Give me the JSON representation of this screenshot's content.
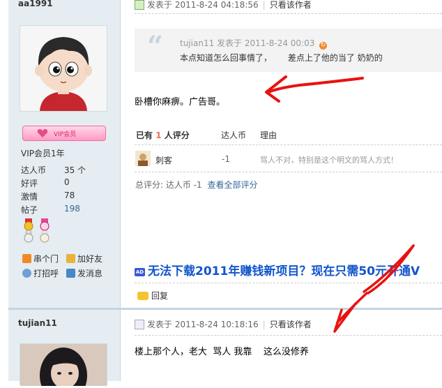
{
  "post1": {
    "author": "aa1991",
    "rank": "VIP会员1年",
    "vip_badge": "VIP会员",
    "stats": [
      {
        "label": "达人币",
        "value": "35 个"
      },
      {
        "label": "好评",
        "value": "0"
      },
      {
        "label": "激情",
        "value": "78"
      },
      {
        "label": "帖子",
        "value": "198"
      }
    ],
    "links": {
      "visit": "串个门",
      "add_friend": "加好友",
      "greet": "打招呼",
      "message": "发消息"
    },
    "time": "发表于 2011-8-24 04:18:56",
    "only_author": "只看该作者",
    "quote": {
      "author": "tujian11",
      "time": "发表于 2011-8-24 00:03",
      "text": "本点知道怎么回事情了，      差点上了他的当了 奶奶的"
    },
    "message": "卧槽你麻痹。广告哥。",
    "rating": {
      "head_prefix": "已有",
      "count": "1",
      "head_suffix": "人评分",
      "col_coin": "达人币",
      "col_reason": "理由",
      "rater": "刺客",
      "coin": "-1",
      "reason": "骂人不对，特别是这个明文的骂人方式！",
      "total_label": "总评分:",
      "total_value": "达人币 -1",
      "view_all": "查看全部评分"
    },
    "ad": "无法下载2011年赚钱新项目？现在只需50元开通V",
    "ad_icon": "AD",
    "reply": "回复"
  },
  "post2": {
    "author": "tujian11",
    "time": "发表于 2011-8-24 10:18:16",
    "only_author": "只看该作者",
    "message": "楼上那个人，老大  骂人 我靠    这么没修养"
  },
  "colors": {
    "annotation": "#e8130f",
    "link": "#336699",
    "ad": "#1155cc",
    "sidebar": "#e5edf2"
  }
}
